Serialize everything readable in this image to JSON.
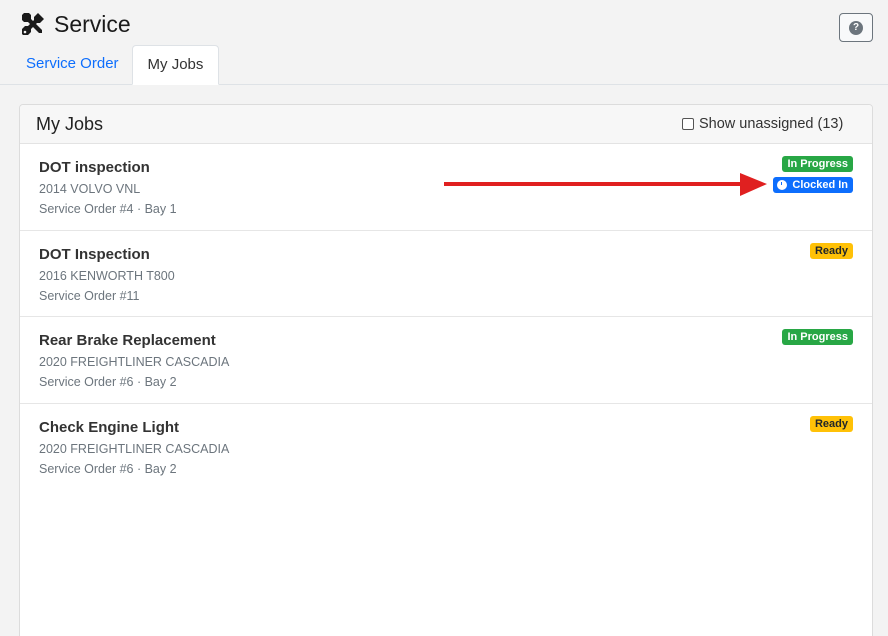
{
  "app": {
    "title": "Service",
    "help_label": "?"
  },
  "tabs": [
    {
      "label": "Service Order",
      "active": false
    },
    {
      "label": "My Jobs",
      "active": true
    }
  ],
  "panel": {
    "title": "My Jobs",
    "show_unassigned_label": "Show unassigned (13)",
    "show_unassigned_checked": false
  },
  "jobs": [
    {
      "title": "DOT inspection",
      "vehicle": "2014 VOLVO VNL",
      "order": "Service Order #4 · Bay 1",
      "status": "In Progress",
      "status_color": "#28a745",
      "clock_label": "Clocked In",
      "clock_color": "#0d6efd"
    },
    {
      "title": "DOT Inspection",
      "vehicle": "2016 KENWORTH T800",
      "order": "Service Order #11",
      "status": "Ready",
      "status_color": "#ffc107"
    },
    {
      "title": "Rear Brake Replacement",
      "vehicle": "2020 FREIGHTLINER CASCADIA",
      "order": "Service Order #6 · Bay 2",
      "status": "In Progress",
      "status_color": "#28a745"
    },
    {
      "title": "Check Engine Light",
      "vehicle": "2020 FREIGHTLINER CASCADIA",
      "order": "Service Order #6 · Bay 2",
      "status": "Ready",
      "status_color": "#ffc107"
    }
  ],
  "annotation": {
    "arrow_color": "#e02020",
    "icon": "arrow-right-icon"
  }
}
